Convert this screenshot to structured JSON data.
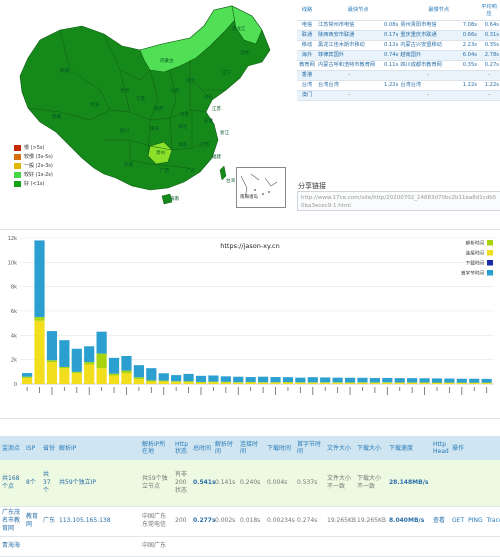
{
  "map": {
    "legend": [
      {
        "label": "慢 (>5s)",
        "color": "#c62808"
      },
      {
        "label": "较慢 (3s-5s)",
        "color": "#d4700c"
      },
      {
        "label": "一般 (2s-3s)",
        "color": "#e0b80c"
      },
      {
        "label": "较好 (1s-2s)",
        "color": "#46d646"
      },
      {
        "label": "好 (<1s)",
        "color": "#16a216"
      }
    ],
    "inset_label": "南海诸岛",
    "colors": {
      "dark": "#16891b",
      "light": "#50df55",
      "lime": "#8be02a",
      "border": "#0e5e13"
    },
    "province_labels": [
      "新疆",
      "西藏",
      "青海",
      "甘肃",
      "内蒙古",
      "黑龙江",
      "吉林",
      "辽宁",
      "宁夏",
      "陕西",
      "山西",
      "河北",
      "山东",
      "河南",
      "四川",
      "重庆",
      "湖北",
      "安徽",
      "江苏",
      "浙江",
      "湖南",
      "江西",
      "福建",
      "贵州",
      "云南",
      "广西",
      "广东",
      "台湾",
      "海南"
    ]
  },
  "isp": {
    "headers": [
      "线路",
      "最快节点",
      "最慢节点",
      "平均响应"
    ],
    "rows": [
      {
        "isp": "电信",
        "fast": "江苏常州市电信",
        "fast_t": "0.08s",
        "slow": "贵州贵阳市电信",
        "slow_t": "7.08s",
        "avg": "0.64s"
      },
      {
        "isp": "联通",
        "fast": "陕西西安市联通",
        "fast_t": "0.17s",
        "slow": "重庆重庆市联通",
        "slow_t": "0.66s",
        "avg": "0.31s"
      },
      {
        "isp": "移动",
        "fast": "黑龙江佳木斯市移动",
        "fast_t": "0.12s",
        "slow": "内蒙古兴安盟移动",
        "slow_t": "2.23s",
        "avg": "0.35s"
      },
      {
        "isp": "海外",
        "fast": "菲律宾国外",
        "fast_t": "0.74s",
        "slow": "越南国外",
        "slow_t": "6.04s",
        "avg": "2.78s"
      },
      {
        "isp": "教育网",
        "fast": "内蒙古呼和浩特市教育网",
        "fast_t": "0.11s",
        "slow": "四川成都市教育网",
        "slow_t": "0.35s",
        "avg": "0.27s"
      },
      {
        "isp": "香港",
        "fast": "-",
        "fast_t": "",
        "slow": "-",
        "slow_t": "",
        "avg": "-"
      },
      {
        "isp": "台湾",
        "fast": "台湾台湾",
        "fast_t": "1.22s",
        "slow": "台湾台湾",
        "slow_t": "1.22s",
        "avg": "1.22s"
      },
      {
        "isp": "澳门",
        "fast": "-",
        "fast_t": "",
        "slow": "-",
        "slow_t": "",
        "avg": "-"
      }
    ],
    "share_title": "分享链接",
    "share_url": "http://www.17ce.com/site/http/20200702_14883d70bc2b11ea8d1cdb50ba3ecec9:1.html"
  },
  "chart_data": {
    "type": "bar",
    "title": "https://jason-xy.cn",
    "ylim": [
      0,
      12000
    ],
    "yticks": [
      0,
      2000,
      4000,
      6000,
      8000,
      10000,
      12000
    ],
    "ytick_labels": [
      "0",
      "2k",
      "4k",
      "6k",
      "8k",
      "10k",
      "12k"
    ],
    "legend_position": "top-right",
    "series": [
      {
        "name": "解析时间",
        "color": "#a8d40e"
      },
      {
        "name": "连接时间",
        "color": "#f2de1c"
      },
      {
        "name": "下载时间",
        "color": "#1a2aa8"
      },
      {
        "name": "首字节时间",
        "color": "#2a9fd0"
      }
    ],
    "values": [
      [
        100,
        500,
        0,
        300
      ],
      [
        300,
        5200,
        0,
        6300
      ],
      [
        150,
        1800,
        0,
        2400
      ],
      [
        100,
        1300,
        0,
        2200
      ],
      [
        100,
        900,
        0,
        1900
      ],
      [
        200,
        1600,
        0,
        1300
      ],
      [
        1200,
        1300,
        0,
        1800
      ],
      [
        150,
        700,
        0,
        1300
      ],
      [
        200,
        900,
        0,
        1200
      ],
      [
        150,
        400,
        0,
        1000
      ],
      [
        100,
        200,
        0,
        1000
      ],
      [
        80,
        200,
        0,
        600
      ],
      [
        50,
        180,
        0,
        500
      ],
      [
        80,
        150,
        0,
        600
      ],
      [
        50,
        120,
        0,
        500
      ],
      [
        50,
        150,
        0,
        500
      ],
      [
        60,
        120,
        0,
        450
      ],
      [
        50,
        100,
        0,
        450
      ],
      [
        50,
        120,
        0,
        400
      ],
      [
        40,
        110,
        0,
        450
      ],
      [
        50,
        100,
        0,
        420
      ],
      [
        40,
        120,
        0,
        400
      ],
      [
        40,
        100,
        0,
        380
      ],
      [
        40,
        100,
        0,
        420
      ],
      [
        40,
        100,
        0,
        400
      ],
      [
        40,
        100,
        0,
        380
      ],
      [
        40,
        90,
        0,
        380
      ],
      [
        40,
        100,
        0,
        370
      ],
      [
        40,
        90,
        0,
        360
      ],
      [
        40,
        100,
        0,
        360
      ],
      [
        40,
        90,
        0,
        350
      ],
      [
        40,
        90,
        0,
        350
      ],
      [
        40,
        90,
        0,
        340
      ],
      [
        40,
        80,
        0,
        340
      ],
      [
        30,
        90,
        0,
        330
      ],
      [
        30,
        80,
        0,
        320
      ],
      [
        30,
        80,
        0,
        320
      ],
      [
        30,
        80,
        0,
        310
      ]
    ]
  },
  "results": {
    "headers": [
      "监测点",
      "ISP",
      "省份",
      "解析IP",
      "解析IP所在地",
      "Http状态",
      "总时间",
      "解析时间",
      "连接时间",
      "下载时间",
      "首字节时间",
      "文件大小",
      "下载大小",
      "下载速度",
      "Http Head",
      "操作"
    ],
    "summary": {
      "node": "共168个点",
      "isp": "8个",
      "prov": "共37个",
      "ip": "共59个独立IP",
      "loc": "共59个独立节点",
      "http": "有非200状态",
      "total": "0.541s",
      "resolve": "0.141s",
      "connect": "0.240s",
      "download": "0.004s",
      "firstbyte": "0.537s",
      "filesize": "文件大小不一致",
      "dlsize": "下载大小不一致",
      "speed": "28.148MB/s"
    },
    "rows": [
      {
        "node": "广东茂名市教育网",
        "isp": "教育网",
        "prov": "广东",
        "ip": "113.105.165.138",
        "loc": "中国广东东莞电信",
        "http": "200",
        "total": "0.277s",
        "resolve": "0.002s",
        "connect": "0.018s",
        "download": "0.00234s",
        "firstbyte": "0.274s",
        "filesize": "19.265KB",
        "dlsize": "19.265KB",
        "speed": "8.040MB/s",
        "head": "查看",
        "actions": [
          "GET",
          "PING",
          "Trace",
          "Dig"
        ]
      },
      {
        "node": "青海海",
        "isp": "",
        "prov": "",
        "ip": "",
        "loc": "中国广东",
        "http": "",
        "total": "",
        "resolve": "",
        "connect": "",
        "download": "",
        "firstbyte": "",
        "filesize": "",
        "dlsize": "",
        "speed": "",
        "head": "",
        "actions": []
      }
    ]
  }
}
